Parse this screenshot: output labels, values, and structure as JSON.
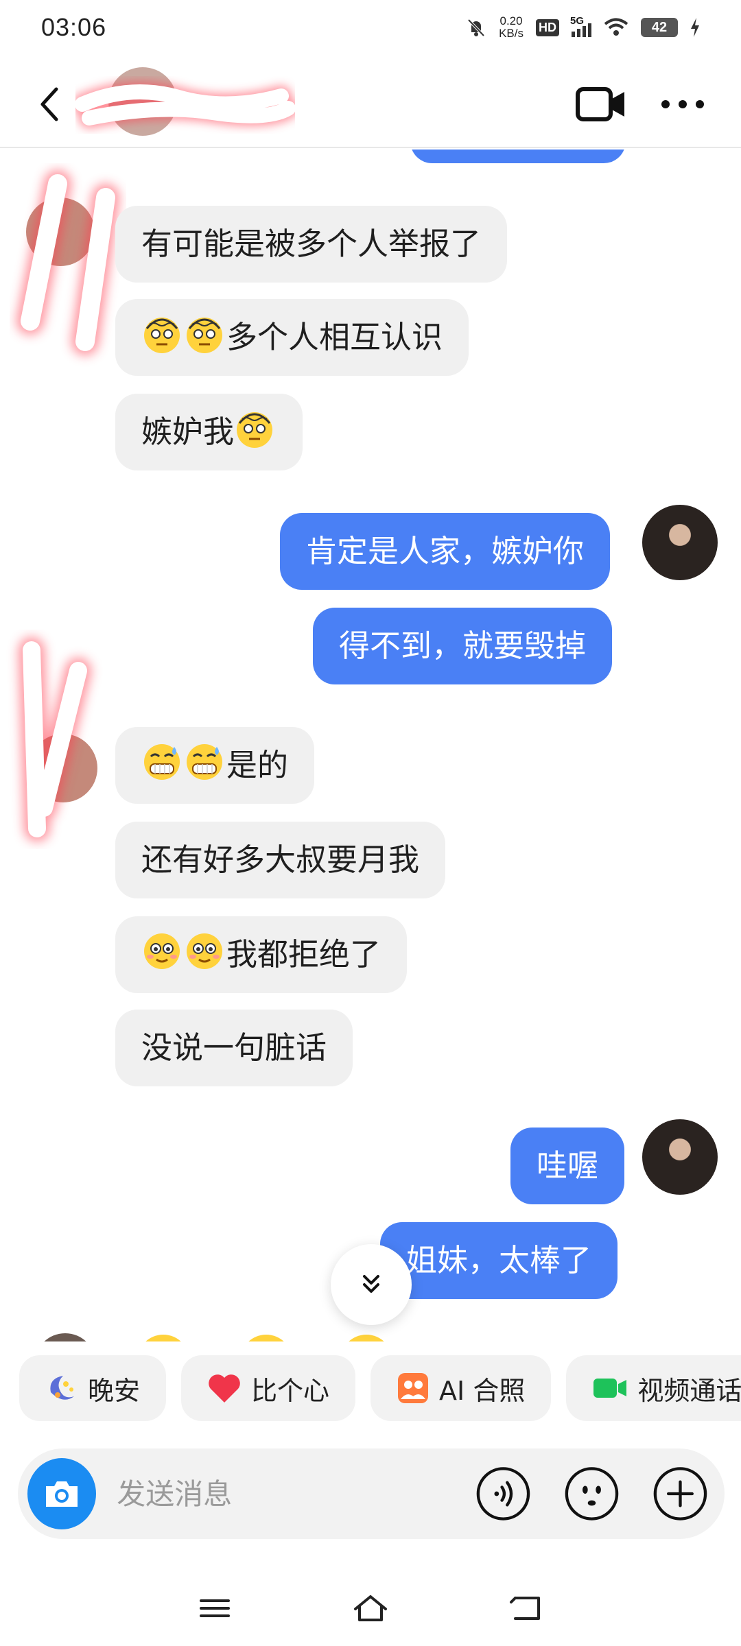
{
  "status_bar": {
    "time": "03:06",
    "net_speed_value": "0.20",
    "net_speed_unit": "KB/s",
    "hd_label": "HD",
    "network_label": "5G",
    "battery": "42"
  },
  "header": {
    "contact_name": "",
    "icons": [
      "back-arrow-icon",
      "video-camera-icon",
      "more-dots-icon"
    ]
  },
  "messages": [
    {
      "side": "in",
      "text": "有可能是被多个人举报了",
      "emoji_prefix": []
    },
    {
      "side": "in",
      "text": "多个人相互认识",
      "emoji_prefix": [
        "dizzy-face",
        "dizzy-face"
      ]
    },
    {
      "side": "in",
      "text": "嫉妒我",
      "emoji_suffix": [
        "dizzy-face"
      ]
    },
    {
      "side": "out",
      "text": "肯定是人家，嫉妒你"
    },
    {
      "side": "out",
      "text": "得不到，就要毁掉"
    },
    {
      "side": "in",
      "text": "是的",
      "emoji_prefix": [
        "grimace-sweat",
        "grimace-sweat"
      ]
    },
    {
      "side": "in",
      "text": "还有好多大叔要月我"
    },
    {
      "side": "in",
      "text": "我都拒绝了",
      "emoji_prefix": [
        "flushed-smile",
        "flushed-smile"
      ]
    },
    {
      "side": "in",
      "text": "没说一句脏话"
    },
    {
      "side": "out",
      "text": "哇喔"
    },
    {
      "side": "out",
      "text": "姐妹，太棒了"
    }
  ],
  "quick_actions": [
    {
      "label": "晚安",
      "icon": "moon-night-icon"
    },
    {
      "label": "比个心",
      "icon": "heart-icon"
    },
    {
      "label": "AI 合照",
      "icon": "ai-photo-icon"
    },
    {
      "label": "视频通话",
      "icon": "video-call-icon"
    }
  ],
  "input": {
    "placeholder": "发送消息"
  },
  "colors": {
    "outgoing_bubble": "#4a80f5",
    "incoming_bubble": "#f0f0f0",
    "camera_button": "#1b8cf2"
  }
}
